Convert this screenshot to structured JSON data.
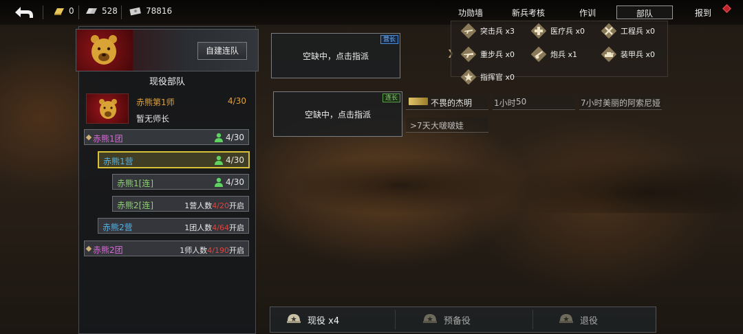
{
  "topbar": {
    "resources": [
      {
        "icon": "gold-bar-icon",
        "value": "0"
      },
      {
        "icon": "silver-bar-icon",
        "value": "528"
      },
      {
        "icon": "cash-icon",
        "value": "78816"
      }
    ],
    "nav": [
      "功勋墙",
      "新兵考核",
      "作训",
      "部队",
      "报到"
    ],
    "active_nav": "部队"
  },
  "left_panel": {
    "create_button": "自建连队",
    "section_title": "现役部队",
    "division": {
      "name": "赤熊第1师",
      "count": "4/30",
      "commander": "暂无师长"
    },
    "units": [
      {
        "name": "赤熊1团",
        "count": "4/30",
        "level": "regiment"
      },
      {
        "name": "赤熊1营",
        "count": "4/30",
        "level": "battalion",
        "selected": true
      },
      {
        "name": "赤熊1[连]",
        "count": "4/30",
        "level": "company"
      },
      {
        "name": "赤熊2[连]",
        "req_prefix": "1营人数",
        "req_value": "4/20",
        "req_suffix": "开启",
        "level": "company"
      },
      {
        "name": "赤熊2营",
        "req_prefix": "1团人数",
        "req_value": "4/64",
        "req_suffix": "开启",
        "level": "battalion"
      },
      {
        "name": "赤熊2团",
        "req_prefix": "1师人数",
        "req_value": "4/190",
        "req_suffix": "开启",
        "level": "regiment"
      }
    ]
  },
  "slots": [
    {
      "text": "空缺中，点击指派",
      "badge": "营长"
    },
    {
      "text": "空缺中，点击指派",
      "badge": "连长"
    }
  ],
  "soldier_types": [
    {
      "icon": "assault-rifle-icon",
      "label": "突击兵 x3"
    },
    {
      "icon": "medic-icon",
      "label": "医疗兵 x0"
    },
    {
      "icon": "engineer-icon",
      "label": "工程兵 x0"
    },
    {
      "icon": "heavy-infantry-icon",
      "label": "重步兵 x0"
    },
    {
      "icon": "artillery-icon",
      "label": "炮兵 x1"
    },
    {
      "icon": "tank-icon",
      "label": "装甲兵 x0"
    },
    {
      "icon": "commander-icon",
      "label": "指挥官 x0"
    }
  ],
  "candidates": [
    {
      "name": "不畏的杰明"
    },
    {
      "time": "1小时",
      "value": "50"
    },
    {
      "time": "7小时",
      "name": "美丽的阿索尼娅"
    },
    {
      "time": ">7天",
      "name": "大啵啵娃"
    }
  ],
  "bottom_tabs": [
    {
      "label": "现役 x4",
      "active": true
    },
    {
      "label": "预备役",
      "active": false
    },
    {
      "label": "退役",
      "active": false
    }
  ]
}
